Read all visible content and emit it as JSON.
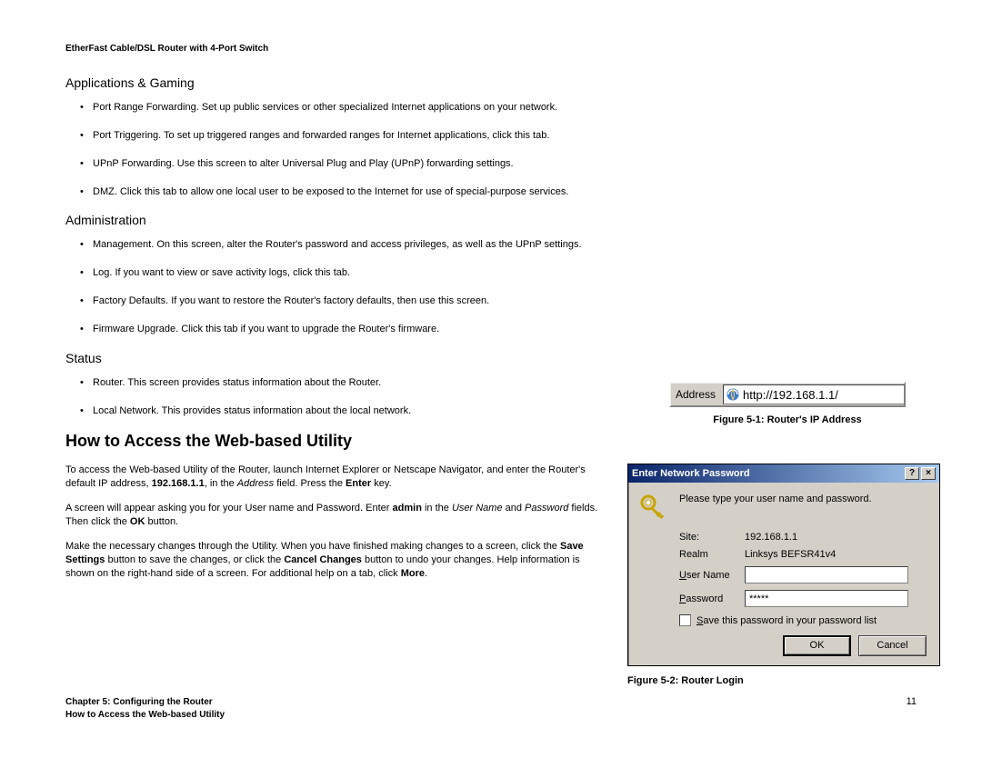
{
  "doc_title": "EtherFast Cable/DSL Router with 4-Port Switch",
  "sections": {
    "apps_gaming": {
      "heading": "Applications & Gaming",
      "items": [
        "Port Range Forwarding. Set up public services or other specialized Internet applications on your network.",
        "Port Triggering. To set up triggered ranges and forwarded ranges for Internet applications, click this tab.",
        "UPnP Forwarding. Use this screen to alter Universal Plug and Play (UPnP) forwarding settings.",
        "DMZ. Click this tab to allow one local user to be exposed to the Internet for use of special-purpose services."
      ]
    },
    "administration": {
      "heading": "Administration",
      "items": [
        "Management. On this screen, alter the Router's password and access privileges, as well as the UPnP settings.",
        "Log. If you want to view or save activity logs, click this tab.",
        "Factory Defaults. If you want to restore the Router's factory defaults, then use this screen.",
        "Firmware Upgrade. Click this tab if you want to upgrade the Router's firmware."
      ]
    },
    "status": {
      "heading": "Status",
      "items": [
        "Router. This screen provides status information about the Router.",
        "Local Network. This provides status information about the local network."
      ]
    }
  },
  "main_heading": "How to Access the Web-based Utility",
  "paragraphs": {
    "p1_a": "To access the Web-based Utility of the Router, launch Internet Explorer or Netscape Navigator, and enter the Router's default IP address, ",
    "p1_ip": "192.168.1.1",
    "p1_b": ", in the ",
    "p1_address": "Address",
    "p1_c": " field. Press the ",
    "p1_enter": "Enter",
    "p1_d": " key.",
    "p2_a": "A screen will appear asking you for your User name and Password. Enter ",
    "p2_admin": "admin",
    "p2_b": " in the ",
    "p2_un": "User Name",
    "p2_c": " and ",
    "p2_pw": "Password",
    "p2_d": " fields. Then click the ",
    "p2_ok": "OK",
    "p2_e": " button.",
    "p3_a": "Make the necessary changes through the Utility. When you have finished making changes to a screen, click the ",
    "p3_save": "Save Settings",
    "p3_b": " button to save the changes, or click the ",
    "p3_cancel": "Cancel Changes",
    "p3_c": " button to undo your changes. Help information is shown on the right-hand side of a screen. For additional help on a tab, click ",
    "p3_more": "More",
    "p3_d": "."
  },
  "figure1": {
    "address_label": "Address",
    "url": "http://192.168.1.1/",
    "caption": "Figure 5-1: Router's IP Address"
  },
  "figure2": {
    "title": "Enter Network Password",
    "prompt": "Please type your user name and password.",
    "site_label": "Site:",
    "site_value": "192.168.1.1",
    "realm_label": "Realm",
    "realm_value": "Linksys BEFSR41v4",
    "username_label_pre": "U",
    "username_label": "ser Name",
    "password_label_pre": "P",
    "password_label": "assword",
    "password_value": "*****",
    "save_pre": "S",
    "save_label": "ave this password in your password list",
    "ok": "OK",
    "cancel": "Cancel",
    "help_btn": "?",
    "close_btn": "×",
    "caption": "Figure 5-2: Router Login"
  },
  "footer": {
    "chapter": "Chapter 5: Configuring the Router",
    "section": "How to Access the Web-based Utility",
    "page": "11"
  }
}
